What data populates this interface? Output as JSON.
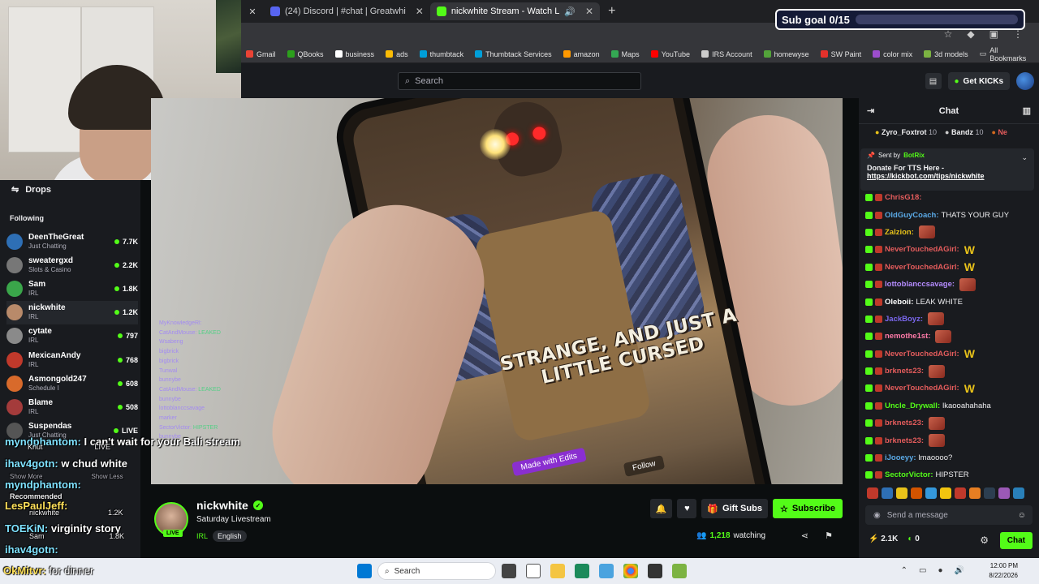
{
  "browser": {
    "tabs": [
      {
        "label": "(24) Discord | #chat | Greatwhi",
        "color": "#5865f2"
      },
      {
        "label": "nickwhite Stream - Watch L",
        "color": "#53fc18"
      }
    ],
    "bookmarks": [
      "Gmail",
      "QBooks",
      "business",
      "ads",
      "thumbtack",
      "Thumbtack Services",
      "amazon",
      "Maps",
      "YouTube",
      "IRS Account",
      "homewyse",
      "SW Paint",
      "color mix",
      "3d models"
    ],
    "all_bookmarks": "All Bookmarks"
  },
  "header": {
    "search_placeholder": "Search",
    "get_kicks": "Get KICKs"
  },
  "sub_goal": "Sub goal 0/15",
  "sidebar": {
    "drops": "Drops",
    "following": "Following",
    "channels": [
      {
        "name": "DeenTheGreat",
        "category": "Just Chatting",
        "viewers": "7.7K",
        "color": "#2e6fb5"
      },
      {
        "name": "sweatergxd",
        "category": "Slots & Casino",
        "viewers": "2.2K",
        "color": "#777777"
      },
      {
        "name": "Sam",
        "category": "IRL",
        "viewers": "1.8K",
        "color": "#3aa64a"
      },
      {
        "name": "nickwhite",
        "category": "IRL",
        "viewers": "1.2K",
        "color": "#b88a6a"
      },
      {
        "name": "cytate",
        "category": "IRL",
        "viewers": "797",
        "color": "#8a8a8a"
      },
      {
        "name": "MexicanAndy",
        "category": "IRL",
        "viewers": "768",
        "color": "#c0392b"
      },
      {
        "name": "Asmongold247",
        "category": "Schedule I",
        "viewers": "608",
        "color": "#d86a2b"
      },
      {
        "name": "Blame",
        "category": "IRL",
        "viewers": "508",
        "color": "#a43b3b"
      },
      {
        "name": "Suspendas",
        "category": "Just Chatting",
        "viewers": "LIVE",
        "color": "#555555"
      }
    ]
  },
  "overlay_lines": [
    {
      "user": "myndphantom:",
      "text": "I can't wait for your Bali stream"
    },
    {
      "user": "ihav4gotn:",
      "text": "w chud white"
    },
    {
      "user": "myndphantom:",
      "text": ""
    },
    {
      "user": "LesPaulJeff:",
      "text": ""
    },
    {
      "user": "TOEKiN:",
      "text": "virginity story"
    },
    {
      "user": "ihav4gotn:",
      "text": ""
    },
    {
      "user": "OkMitvr:",
      "text": "for dinner"
    }
  ],
  "overlay_sidebar": {
    "knut": "Knut",
    "knut_live": "LIVE",
    "show_more": "Show More",
    "show_less": "Show Less",
    "recommended": "Recommended",
    "rec1_name": "nickwhite",
    "rec1_viewers": "1.2K",
    "rec2_name": "Sam",
    "rec2_viewers": "1.8K"
  },
  "video": {
    "caption_line1": "STRANGE, AND JUST A",
    "caption_line2": "LITTLE CURSED",
    "made_with": "Made with Edits",
    "follow": "Follow",
    "overlay_chat": [
      {
        "user": "MyKnowledgeRl:",
        "text": ""
      },
      {
        "user": "CatAndMouse:",
        "text": "LEAKED"
      },
      {
        "user": "Wsabeng",
        "text": ""
      },
      {
        "user": "bigbrick",
        "text": ""
      },
      {
        "user": "bigbrick",
        "text": ""
      },
      {
        "user": "Tunwal",
        "text": ""
      },
      {
        "user": "bunnybe",
        "text": ""
      },
      {
        "user": "CatAndMouse:",
        "text": "LEAKED"
      },
      {
        "user": "bunnybe",
        "text": ""
      },
      {
        "user": "lottoblanccsavage",
        "text": ""
      },
      {
        "user": "marker",
        "text": ""
      },
      {
        "user": "SectorVictor:",
        "text": "HIPSTER"
      },
      {
        "user": "bunnybe",
        "text": ""
      }
    ]
  },
  "streamer": {
    "name": "nickwhite",
    "title": "Saturday Livestream",
    "category": "IRL",
    "language": "English",
    "live": "LIVE",
    "gift_subs": "Gift Subs",
    "subscribe": "Subscribe",
    "watching_count": "1,218",
    "watching_label": "watching"
  },
  "chat": {
    "title": "Chat",
    "gifters": [
      {
        "name": "Zyro_Foxtrot",
        "count": "10"
      },
      {
        "name": "Bandz",
        "count": "10"
      },
      {
        "name": "Ne",
        "count": ""
      }
    ],
    "pinned": {
      "sent_by": "Sent by",
      "bot": "BotRix",
      "text": "Donate For TTS Here -",
      "link": "https://kickbot.com/tips/nickwhite"
    },
    "messages": [
      {
        "user": "ChrisG18:",
        "text": "",
        "color": "#e45c5c",
        "w": false,
        "emo": false
      },
      {
        "user": "OldGuyCoach:",
        "text": "THATS YOUR GUY",
        "color": "#5aa9e6",
        "w": false,
        "emo": false
      },
      {
        "user": "Zalzion:",
        "text": "",
        "color": "#e8c21a",
        "w": false,
        "emo": true
      },
      {
        "user": "NeverTouchedAGirl:",
        "text": "",
        "color": "#e45c5c",
        "w": true,
        "emo": false
      },
      {
        "user": "NeverTouchedAGirl:",
        "text": "",
        "color": "#e45c5c",
        "w": true,
        "emo": false
      },
      {
        "user": "lottoblanccsavage:",
        "text": "",
        "color": "#b58cff",
        "w": false,
        "emo": true
      },
      {
        "user": "Oleboii:",
        "text": "LEAK WHITE",
        "color": "#ffffff",
        "w": false,
        "emo": false
      },
      {
        "user": "JackBoyz:",
        "text": "",
        "color": "#7b68ee",
        "w": false,
        "emo": true
      },
      {
        "user": "nemothe1st:",
        "text": "",
        "color": "#ff7aa8",
        "w": false,
        "emo": true
      },
      {
        "user": "NeverTouchedAGirl:",
        "text": "",
        "color": "#e45c5c",
        "w": true,
        "emo": false
      },
      {
        "user": "brknets23:",
        "text": "",
        "color": "#e45c5c",
        "w": false,
        "emo": true
      },
      {
        "user": "NeverTouchedAGirl:",
        "text": "",
        "color": "#e45c5c",
        "w": true,
        "emo": false
      },
      {
        "user": "Uncle_Drywall:",
        "text": "lkaooahahaha",
        "color": "#53fc18",
        "w": false,
        "emo": false
      },
      {
        "user": "brknets23:",
        "text": "",
        "color": "#e45c5c",
        "w": false,
        "emo": true
      },
      {
        "user": "brknets23:",
        "text": "",
        "color": "#e45c5c",
        "w": false,
        "emo": true
      },
      {
        "user": "iJooeyy:",
        "text": "lmaoooo?",
        "color": "#5aa9e6",
        "w": false,
        "emo": false
      },
      {
        "user": "SectorVictor:",
        "text": "HIPSTER",
        "color": "#53fc18",
        "w": false,
        "emo": false
      }
    ],
    "send_placeholder": "Send a message",
    "kicks": "2.1K",
    "points": "0",
    "chat_button": "Chat"
  },
  "taskbar": {
    "search": "Search",
    "time": "12:00 PM",
    "date": "8/22/2026"
  }
}
